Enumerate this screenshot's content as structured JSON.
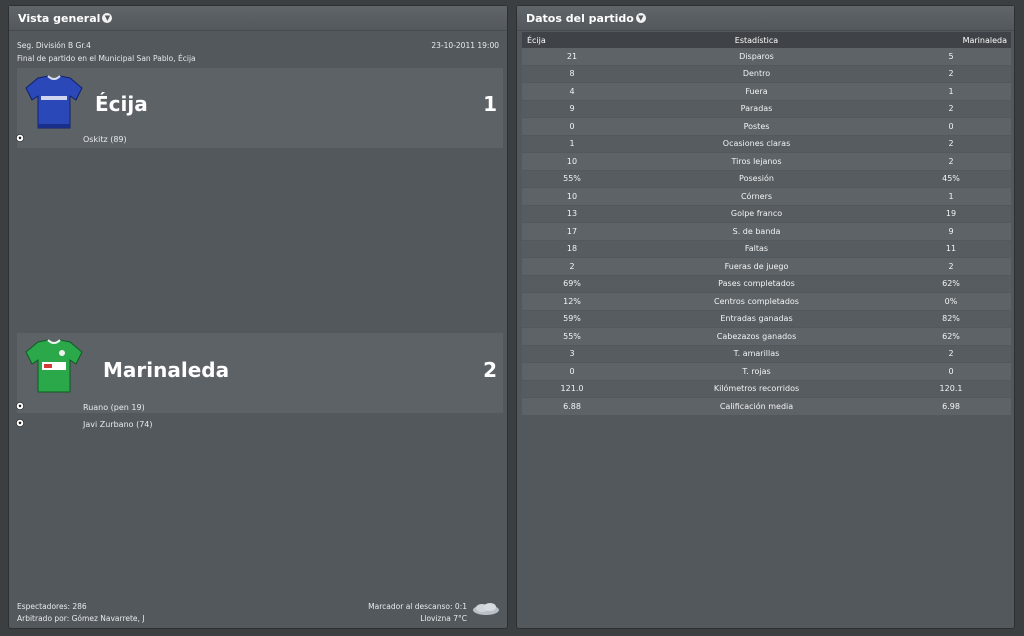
{
  "overview": {
    "title": "Vista general",
    "competition": "Seg. División B Gr.4",
    "date": "23-10-2011 19:00",
    "venue_text": "Final de partido en el Municipal San Pablo, Écija",
    "home": {
      "name": "Écija",
      "score": "1",
      "kit_icon": "blue-shirt-icon",
      "scorers": [
        "Oskitz (89)"
      ]
    },
    "away": {
      "name": "Marinaleda",
      "score": "2",
      "kit_icon": "green-shirt-icon",
      "scorers": [
        "Ruano (pen 19)",
        "Javi Zurbano (74)"
      ]
    },
    "attendance": "Espectadores: 286",
    "referee": "Arbitrado por: Gómez Navarrete, J",
    "halftime": "Marcador al descanso: 0:1",
    "weather": "Llovizna 7°C",
    "weather_icon": "cloud-rain-icon"
  },
  "stats": {
    "title": "Datos del partido",
    "columns": {
      "home": "Écija",
      "stat": "Estadística",
      "away": "Marinaleda"
    },
    "rows": [
      {
        "home": "21",
        "label": "Disparos",
        "away": "5"
      },
      {
        "home": "8",
        "label": "Dentro",
        "away": "2"
      },
      {
        "home": "4",
        "label": "Fuera",
        "away": "1"
      },
      {
        "home": "9",
        "label": "Paradas",
        "away": "2"
      },
      {
        "home": "0",
        "label": "Postes",
        "away": "0"
      },
      {
        "home": "1",
        "label": "Ocasiones claras",
        "away": "2"
      },
      {
        "home": "10",
        "label": "Tiros lejanos",
        "away": "2"
      },
      {
        "home": "55%",
        "label": "Posesión",
        "away": "45%"
      },
      {
        "home": "10",
        "label": "Córners",
        "away": "1"
      },
      {
        "home": "13",
        "label": "Golpe franco",
        "away": "19"
      },
      {
        "home": "17",
        "label": "S. de banda",
        "away": "9"
      },
      {
        "home": "18",
        "label": "Faltas",
        "away": "11"
      },
      {
        "home": "2",
        "label": "Fueras de juego",
        "away": "2"
      },
      {
        "home": "69%",
        "label": "Pases completados",
        "away": "62%"
      },
      {
        "home": "12%",
        "label": "Centros completados",
        "away": "0%"
      },
      {
        "home": "59%",
        "label": "Entradas ganadas",
        "away": "82%"
      },
      {
        "home": "55%",
        "label": "Cabezazos ganados",
        "away": "62%"
      },
      {
        "home": "3",
        "label": "T. amarillas",
        "away": "2"
      },
      {
        "home": "0",
        "label": "T. rojas",
        "away": "0"
      },
      {
        "home": "121.0",
        "label": "Kilómetros recorridos",
        "away": "120.1"
      },
      {
        "home": "6.88",
        "label": "Calificación media",
        "away": "6.98"
      }
    ]
  }
}
